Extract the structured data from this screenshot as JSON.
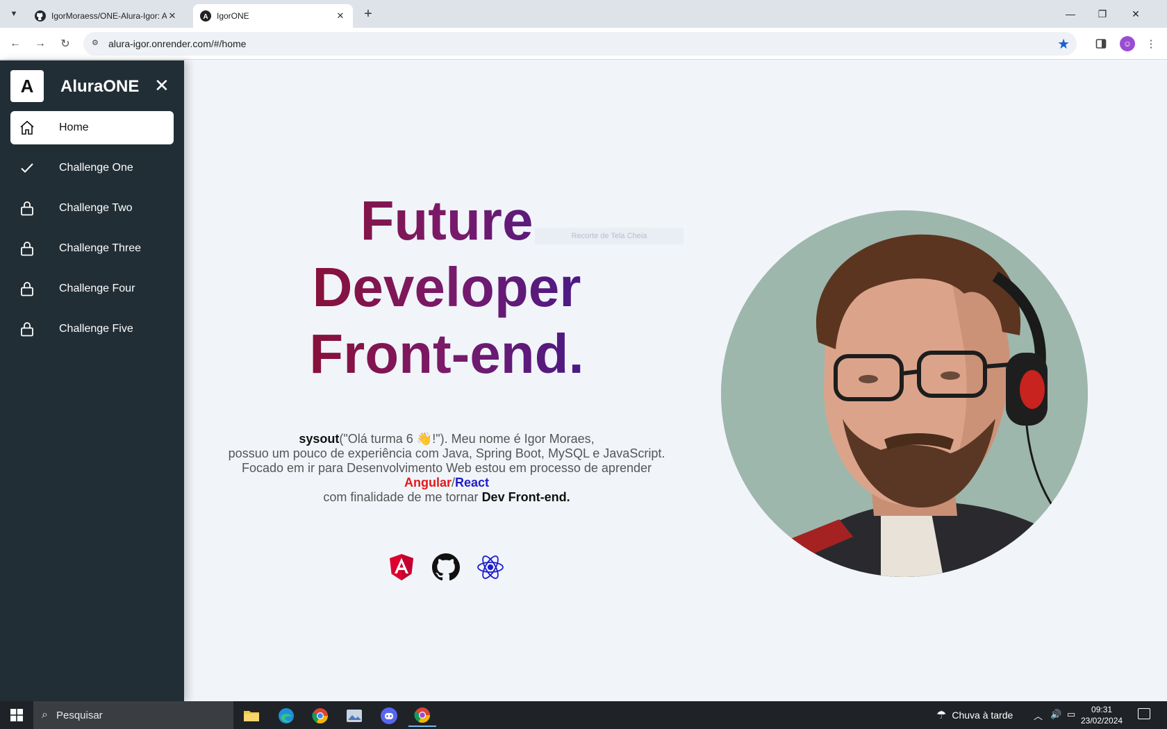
{
  "browser": {
    "tabs": [
      {
        "title": "IgorMoraess/ONE-Alura-Igor: A",
        "active": false
      },
      {
        "title": "IgorONE",
        "active": true
      }
    ],
    "url": "alura-igor.onrender.com/#/home"
  },
  "sidebar": {
    "logo_letter": "A",
    "brand": "AluraONE",
    "items": [
      {
        "label": "Home",
        "icon": "home-icon",
        "active": true
      },
      {
        "label": "Challenge One",
        "icon": "check-icon",
        "active": false
      },
      {
        "label": "Challenge Two",
        "icon": "lock-icon",
        "active": false
      },
      {
        "label": "Challenge Three",
        "icon": "lock-icon",
        "active": false
      },
      {
        "label": "Challenge Four",
        "icon": "lock-icon",
        "active": false
      },
      {
        "label": "Challenge Five",
        "icon": "lock-icon",
        "active": false
      }
    ]
  },
  "hero": {
    "line1": "Future",
    "line2": "Developer",
    "line3": "Front-end.",
    "snip_hint": "Recorte de Tela Cheia"
  },
  "bio": {
    "sysout": "sysout",
    "greeting": "(\"Olá turma 6 👋!\"). Meu nome é Igor Moraes,",
    "line2": "possuo um pouco de experiência com Java, Spring Boot, MySQL e JavaScript.",
    "line3": "Focado em ir para Desenvolvimento Web estou em processo de aprender",
    "angular": "Angular",
    "slash": "/",
    "react": "React",
    "line5_prefix": "com finalidade de me tornar",
    "line5_emph": "Dev Front-end."
  },
  "social": [
    "angular-icon",
    "github-icon",
    "react-icon"
  ],
  "taskbar": {
    "search_placeholder": "Pesquisar",
    "weather": "Chuva à tarde",
    "time": "09:31",
    "date": "23/02/2024"
  },
  "colors": {
    "sidebar_bg": "#212e35",
    "page_bg": "#f1f4f9",
    "angular_red": "#e01b1b",
    "react_blue": "#1c1ccd",
    "gradient_start": "#8b0e2c",
    "gradient_end": "#3d1a8c"
  }
}
